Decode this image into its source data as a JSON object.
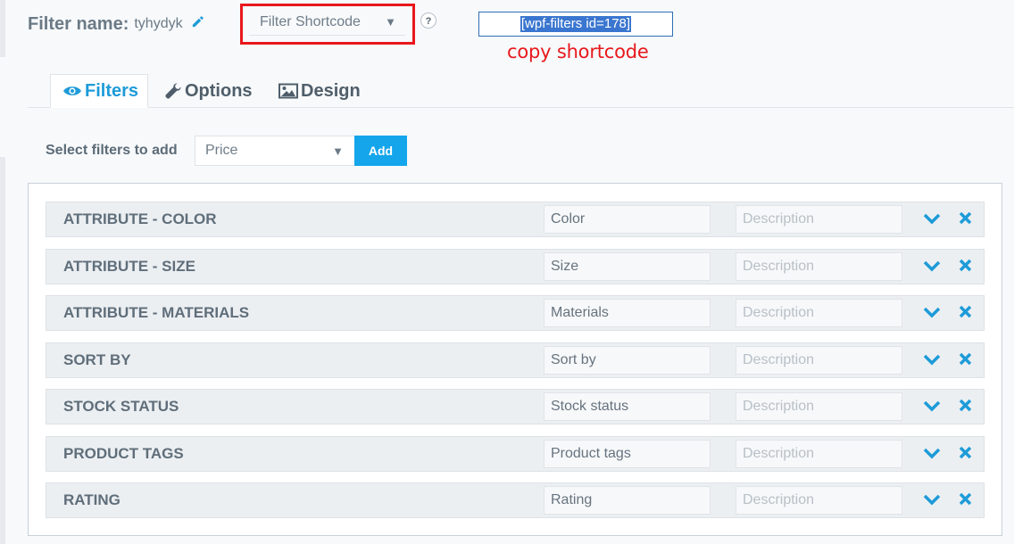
{
  "header": {
    "filter_name_label": "Filter name:",
    "filter_name_value": "tyhydyk",
    "shortcode_select": "Filter Shortcode",
    "help": "?",
    "shortcode_value": "[wpf-filters id=178]",
    "copy_note": "copy shortcode"
  },
  "tabs": [
    {
      "label": "Filters",
      "icon": "eye-icon",
      "active": true
    },
    {
      "label": "Options",
      "icon": "wrench-icon",
      "active": false
    },
    {
      "label": "Design",
      "icon": "image-icon",
      "active": false
    }
  ],
  "add_filter": {
    "label": "Select filters to add",
    "selected": "Price",
    "button": "Add"
  },
  "filters": [
    {
      "title": "ATTRIBUTE - COLOR",
      "name": "Color",
      "description_placeholder": "Description"
    },
    {
      "title": "ATTRIBUTE - SIZE",
      "name": "Size",
      "description_placeholder": "Description"
    },
    {
      "title": "ATTRIBUTE - MATERIALS",
      "name": "Materials",
      "description_placeholder": "Description"
    },
    {
      "title": "SORT BY",
      "name": "Sort by",
      "description_placeholder": "Description"
    },
    {
      "title": "STOCK STATUS",
      "name": "Stock status",
      "description_placeholder": "Description"
    },
    {
      "title": "PRODUCT TAGS",
      "name": "Product tags",
      "description_placeholder": "Description"
    },
    {
      "title": "RATING",
      "name": "Rating",
      "description_placeholder": "Description"
    }
  ],
  "colors": {
    "accent": "#1e9bd8",
    "button": "#14a5eb",
    "highlight_red": "#e8181c"
  }
}
